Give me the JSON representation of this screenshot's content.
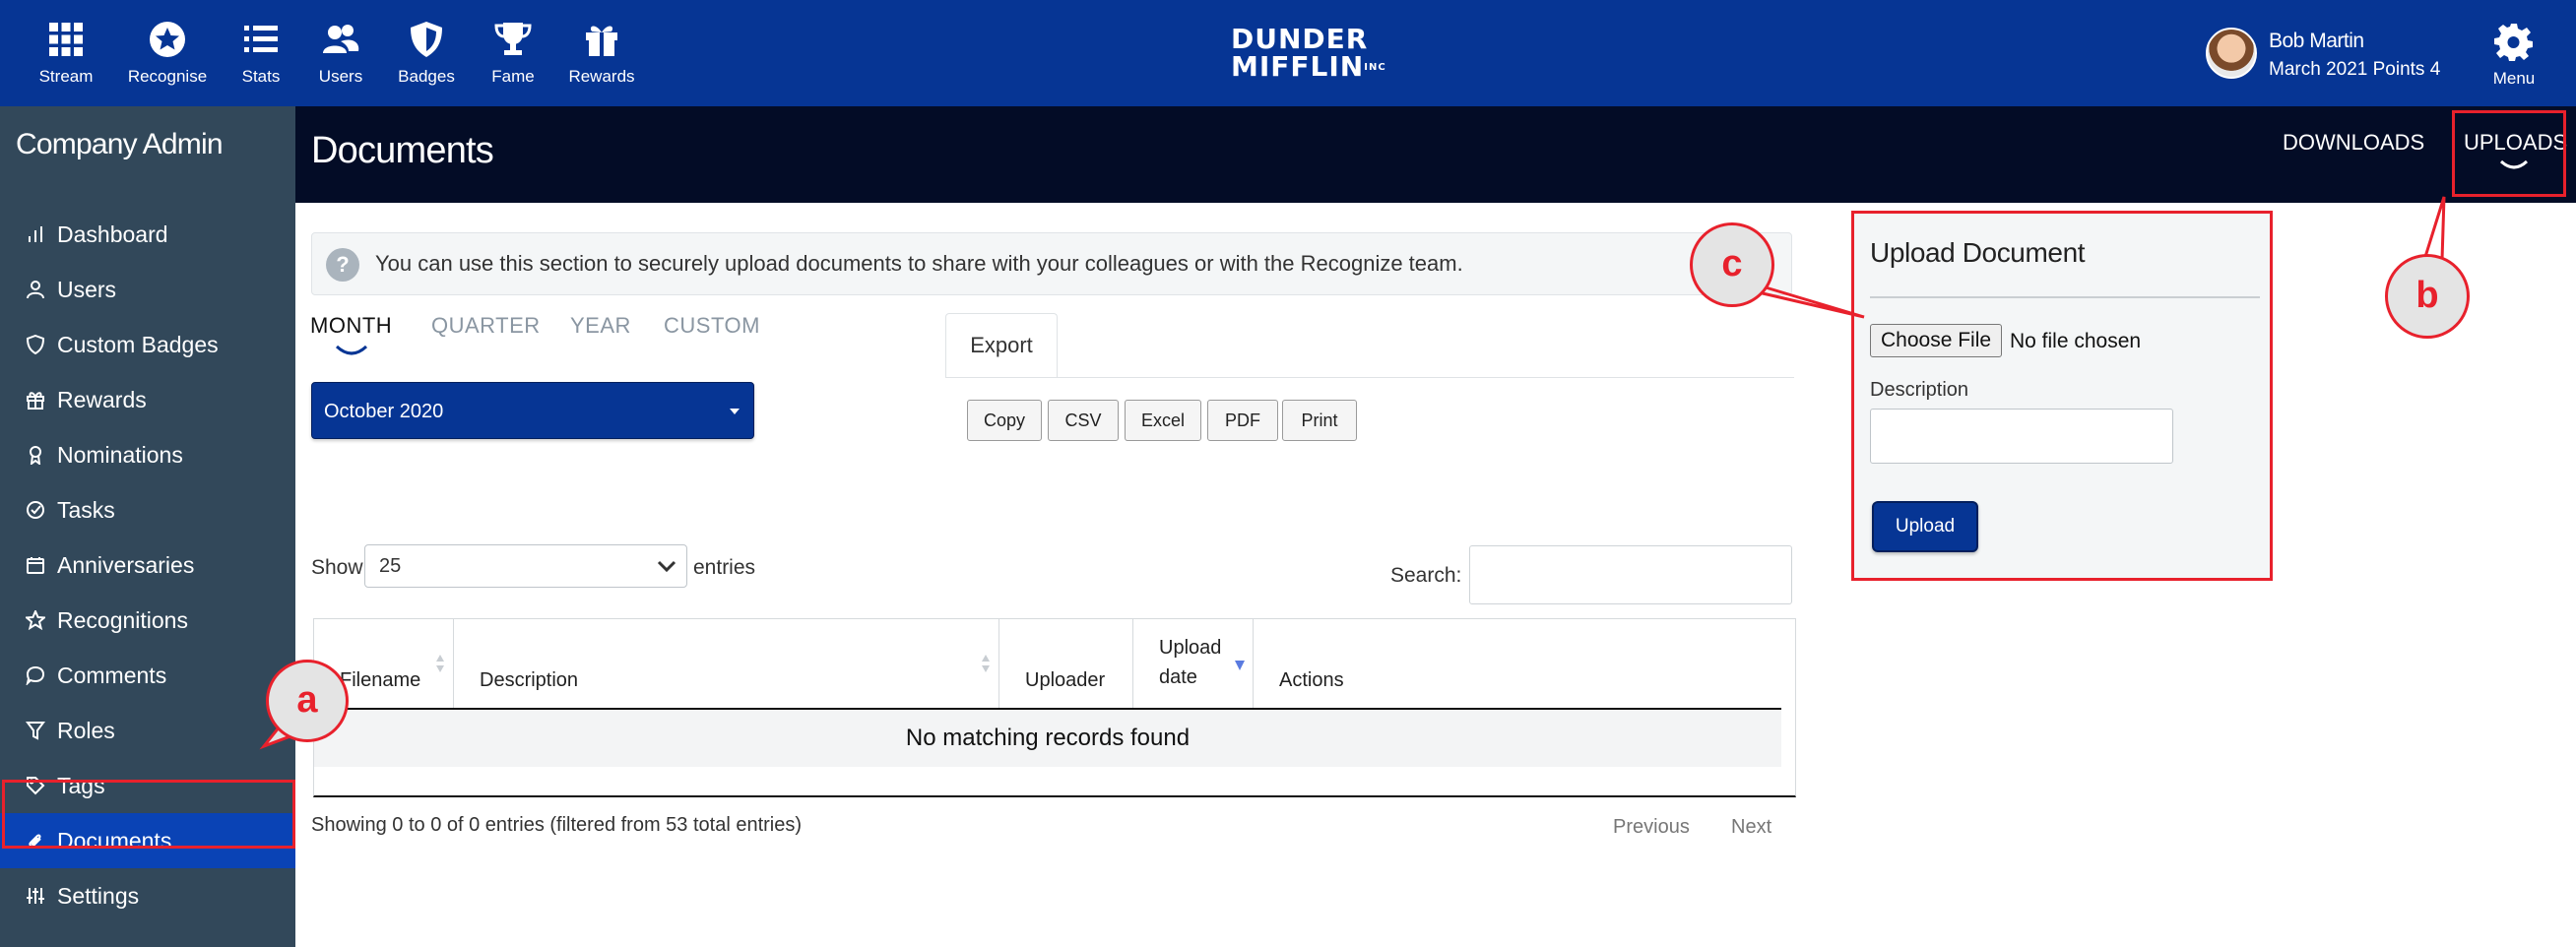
{
  "topnav": {
    "items": [
      {
        "label": "Stream",
        "icon": "grid-icon"
      },
      {
        "label": "Recognise",
        "icon": "star-circle-icon"
      },
      {
        "label": "Stats",
        "icon": "list-icon"
      },
      {
        "label": "Users",
        "icon": "users-icon"
      },
      {
        "label": "Badges",
        "icon": "shield-icon"
      },
      {
        "label": "Fame",
        "icon": "trophy-icon"
      },
      {
        "label": "Rewards",
        "icon": "gift-icon"
      }
    ],
    "logo_line1": "DUNDER",
    "logo_line2": "MIFFLIN",
    "logo_suffix": "INC",
    "user_name": "Bob Martin",
    "user_points": "March 2021 Points 4",
    "menu_label": "Menu"
  },
  "sidebar": {
    "title": "Company Admin",
    "items": [
      {
        "label": "Dashboard",
        "icon": "bar-chart-icon"
      },
      {
        "label": "Users",
        "icon": "user-icon"
      },
      {
        "label": "Custom Badges",
        "icon": "shield-icon"
      },
      {
        "label": "Rewards",
        "icon": "gift-icon"
      },
      {
        "label": "Nominations",
        "icon": "award-icon"
      },
      {
        "label": "Tasks",
        "icon": "check-circle-icon"
      },
      {
        "label": "Anniversaries",
        "icon": "calendar-icon"
      },
      {
        "label": "Recognitions",
        "icon": "star-icon"
      },
      {
        "label": "Comments",
        "icon": "comment-icon"
      },
      {
        "label": "Roles",
        "icon": "filter-icon"
      },
      {
        "label": "Tags",
        "icon": "tag-icon"
      },
      {
        "label": "Documents",
        "icon": "paperclip-icon",
        "active": true
      },
      {
        "label": "Settings",
        "icon": "sliders-icon"
      }
    ]
  },
  "header": {
    "title": "Documents",
    "tab_downloads": "DOWNLOADS",
    "tab_uploads": "UPLOADS"
  },
  "info": {
    "text": "You can use this section to securely upload documents to share with your colleagues or with the Recognize team."
  },
  "periods": [
    {
      "label": "MONTH",
      "active": true
    },
    {
      "label": "QUARTER"
    },
    {
      "label": "YEAR"
    },
    {
      "label": "CUSTOM"
    }
  ],
  "month_select": {
    "value": "October 2020"
  },
  "export": {
    "tab_label": "Export",
    "buttons": [
      "Copy",
      "CSV",
      "Excel",
      "PDF",
      "Print"
    ]
  },
  "table_controls": {
    "show_label": "Show",
    "show_value": "25",
    "entries_label": "entries",
    "search_label": "Search:"
  },
  "table": {
    "columns": [
      "Filename",
      "Description",
      "Uploader",
      "Upload date",
      "Actions"
    ],
    "upload_date_line1": "Upload",
    "upload_date_line2": "date",
    "empty_message": "No matching records found"
  },
  "footer": {
    "showing": "Showing 0 to 0 of 0 entries (filtered from 53 total entries)",
    "previous": "Previous",
    "next": "Next"
  },
  "upload_panel": {
    "title": "Upload Document",
    "choose_file": "Choose File",
    "no_file": "No file chosen",
    "description_label": "Description",
    "upload_button": "Upload"
  },
  "annotations": {
    "a": "a",
    "b": "b",
    "c": "c"
  },
  "colors": {
    "nav_blue": "#063594",
    "header_dark": "#030c26",
    "sidebar": "#32485a",
    "active_blue": "#0a43b5",
    "annotation_red": "#e8212c"
  }
}
